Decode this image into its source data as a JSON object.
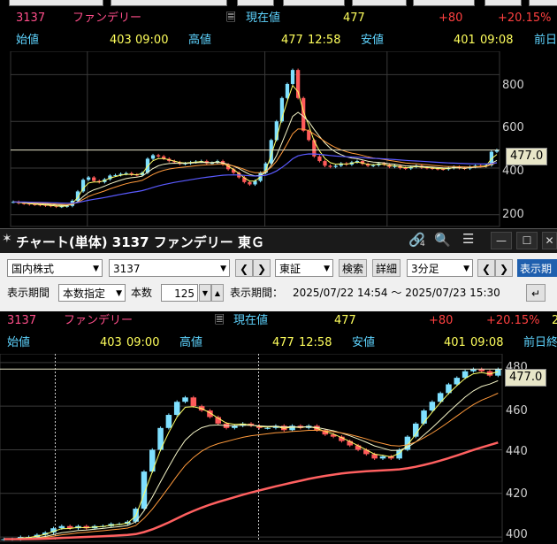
{
  "top_panel": {
    "info": {
      "code": "3137",
      "name": "ファンデリー",
      "current_label": "現在値",
      "current_value": "477",
      "change": "+80",
      "change_pct": "+20.15%",
      "open_label": "始値",
      "open_value": "403",
      "open_time": "09:00",
      "high_label": "高値",
      "high_value": "477",
      "high_time": "12:58",
      "low_label": "安値",
      "low_value": "401",
      "low_time": "09:08",
      "prev_label": "前日"
    },
    "yticks": [
      "800",
      "600",
      "400",
      "200"
    ],
    "price_tag": "477.0"
  },
  "window": {
    "title": "チャート(単体) 3137 ファンデリー 東Ｇ",
    "link_count": "4",
    "icons": [
      "pin-icon",
      "link-icon",
      "search-icon",
      "menu-icon",
      "minimize-icon",
      "maximize-icon",
      "close-icon"
    ]
  },
  "toolbar": {
    "market": "国内株式",
    "code": "3137",
    "exchange": "東証",
    "search_label": "検索",
    "detail_label": "詳細",
    "interval": "3分足",
    "display_period_btn": "表示期間",
    "period_label": "表示期間",
    "period_mode": "本数指定",
    "count_label": "本数",
    "count_value": "125",
    "range_label": "表示期間：",
    "range_value": "2025/07/22 14:54 ～ 2025/07/23 15:30"
  },
  "bottom_panel": {
    "info": {
      "code": "3137",
      "name": "ファンデリー",
      "current_label": "現在値",
      "current_value": "477",
      "change": "+80",
      "change_pct": "+20.15%",
      "extra": "2",
      "open_label": "始値",
      "open_value": "403",
      "open_time": "09:00",
      "high_label": "高値",
      "high_value": "477",
      "high_time": "12:58",
      "low_label": "安値",
      "low_value": "401",
      "low_time": "09:08",
      "prev_label": "前日終"
    },
    "yticks": [
      "480",
      "460",
      "440",
      "420",
      "400"
    ],
    "price_tag": "477.0"
  },
  "colors": {
    "up": "#7fe0ff",
    "down": "#ff5a5a",
    "ma_short": "#ffff66",
    "ma_mid": "#ff9a3c",
    "ma_long_top": "#5a5aff",
    "ma_long_bottom": "#ff6060",
    "ma_white": "#f5f5c8"
  },
  "chart_data": [
    {
      "type": "candlestick",
      "title": "",
      "ylim": [
        150,
        900
      ],
      "ytick_values": [
        800,
        600,
        400,
        200
      ],
      "price_line": 477,
      "close_trace": [
        255,
        250,
        248,
        245,
        244,
        242,
        240,
        238,
        235,
        236,
        238,
        260,
        300,
        350,
        360,
        345,
        340,
        352,
        368,
        370,
        375,
        378,
        372,
        370,
        380,
        440,
        455,
        450,
        440,
        430,
        425,
        418,
        420,
        425,
        428,
        430,
        420,
        422,
        430,
        415,
        395,
        380,
        360,
        340,
        330,
        345,
        380,
        420,
        520,
        600,
        700,
        760,
        820,
        700,
        560,
        520,
        450,
        430,
        410,
        405,
        410,
        420,
        415,
        425,
        430,
        418,
        410,
        412,
        420,
        415,
        405,
        410,
        400,
        398,
        405,
        410,
        402,
        400,
        398,
        396,
        395,
        400,
        405,
        400,
        398,
        405,
        410,
        408,
        412,
        470,
        477
      ]
    },
    {
      "type": "candlestick",
      "title": "",
      "ylim": [
        398,
        484
      ],
      "ytick_values": [
        480,
        460,
        440,
        420,
        400
      ],
      "price_line": 477,
      "close_trace": [
        399,
        399,
        400,
        400,
        401,
        402,
        404,
        405,
        404,
        405,
        404,
        405,
        405,
        406,
        406,
        407,
        413,
        430,
        440,
        450,
        456,
        462,
        464,
        460,
        458,
        455,
        452,
        450,
        451,
        452,
        451,
        450,
        450,
        451,
        449,
        451,
        450,
        451,
        449,
        447,
        446,
        444,
        442,
        440,
        438,
        436,
        437,
        436,
        440,
        446,
        452,
        458,
        462,
        466,
        470,
        473,
        476,
        477,
        476,
        474,
        477
      ]
    }
  ]
}
